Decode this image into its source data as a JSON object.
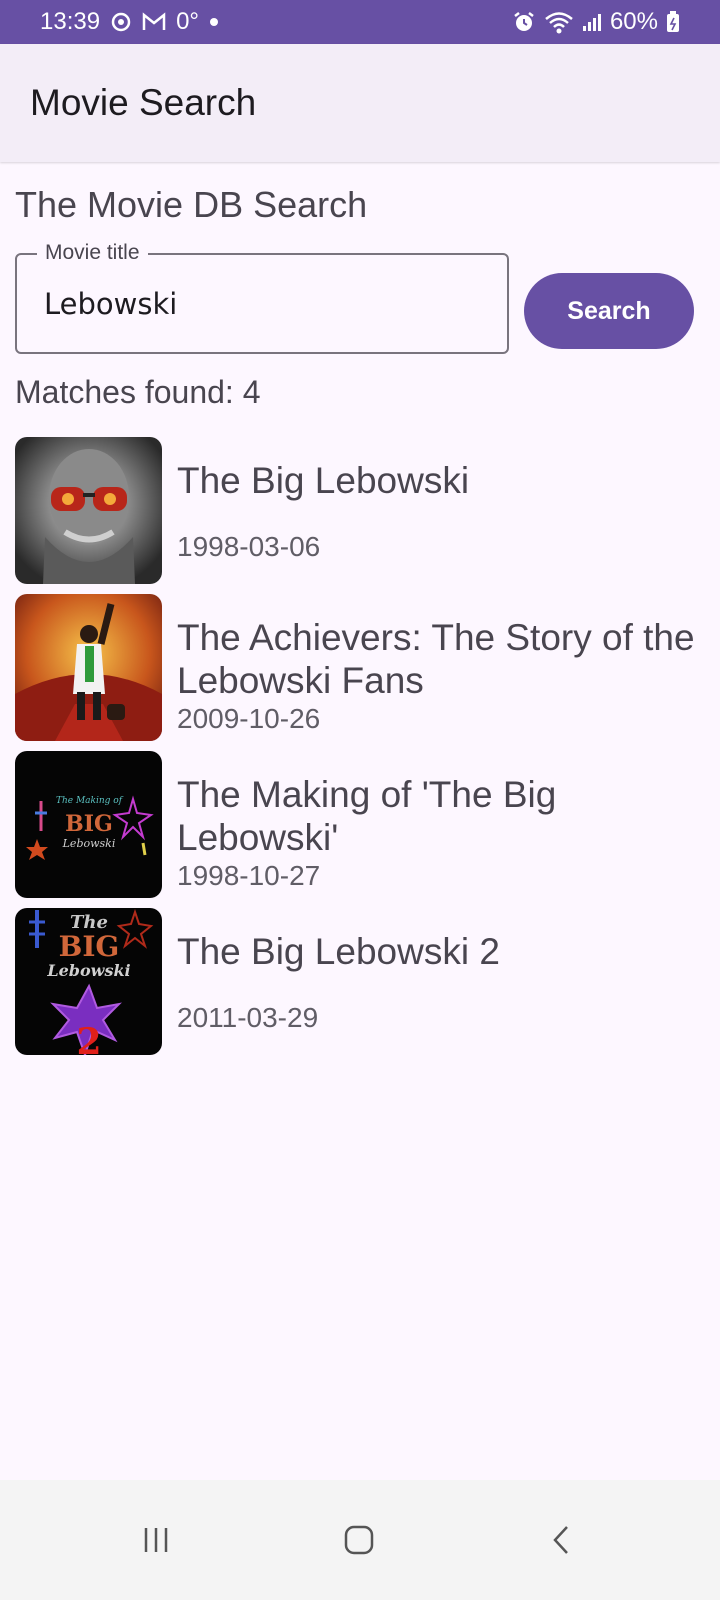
{
  "status_bar": {
    "time": "13:39",
    "temperature": "0°",
    "battery": "60%",
    "icons": [
      "sync-icon",
      "gmail-icon",
      "dot-icon",
      "alarm-icon",
      "wifi-icon",
      "signal-icon",
      "battery-icon"
    ]
  },
  "app_bar": {
    "title": "Movie Search"
  },
  "main": {
    "section_title": "The Movie DB Search",
    "search": {
      "label": "Movie title",
      "value": "Lebowski",
      "button_label": "Search"
    },
    "matches_text": "Matches found: 4",
    "results": [
      {
        "title": "The Big Lebowski",
        "date": "1998-03-06"
      },
      {
        "title": "The Achievers: The Story of the Lebowski Fans",
        "date": "2009-10-26"
      },
      {
        "title": "The Making of 'The Big Lebowski'",
        "date": "1998-10-27"
      },
      {
        "title": "The Big Lebowski 2",
        "date": "2011-03-29"
      }
    ]
  },
  "posters": {
    "poster3_small": "The Making of",
    "poster3_big": "BIG",
    "poster3_lower": "Lebowski",
    "poster4_the": "The",
    "poster4_big": "BIG",
    "poster4_lower": "Lebowski",
    "poster4_num": "2"
  },
  "nav_bar": {
    "icons": [
      "recents-icon",
      "home-icon",
      "back-icon"
    ]
  },
  "colors": {
    "accent": "#6750a4",
    "background": "#fdf7ff",
    "app_bar": "#f3edf7"
  }
}
